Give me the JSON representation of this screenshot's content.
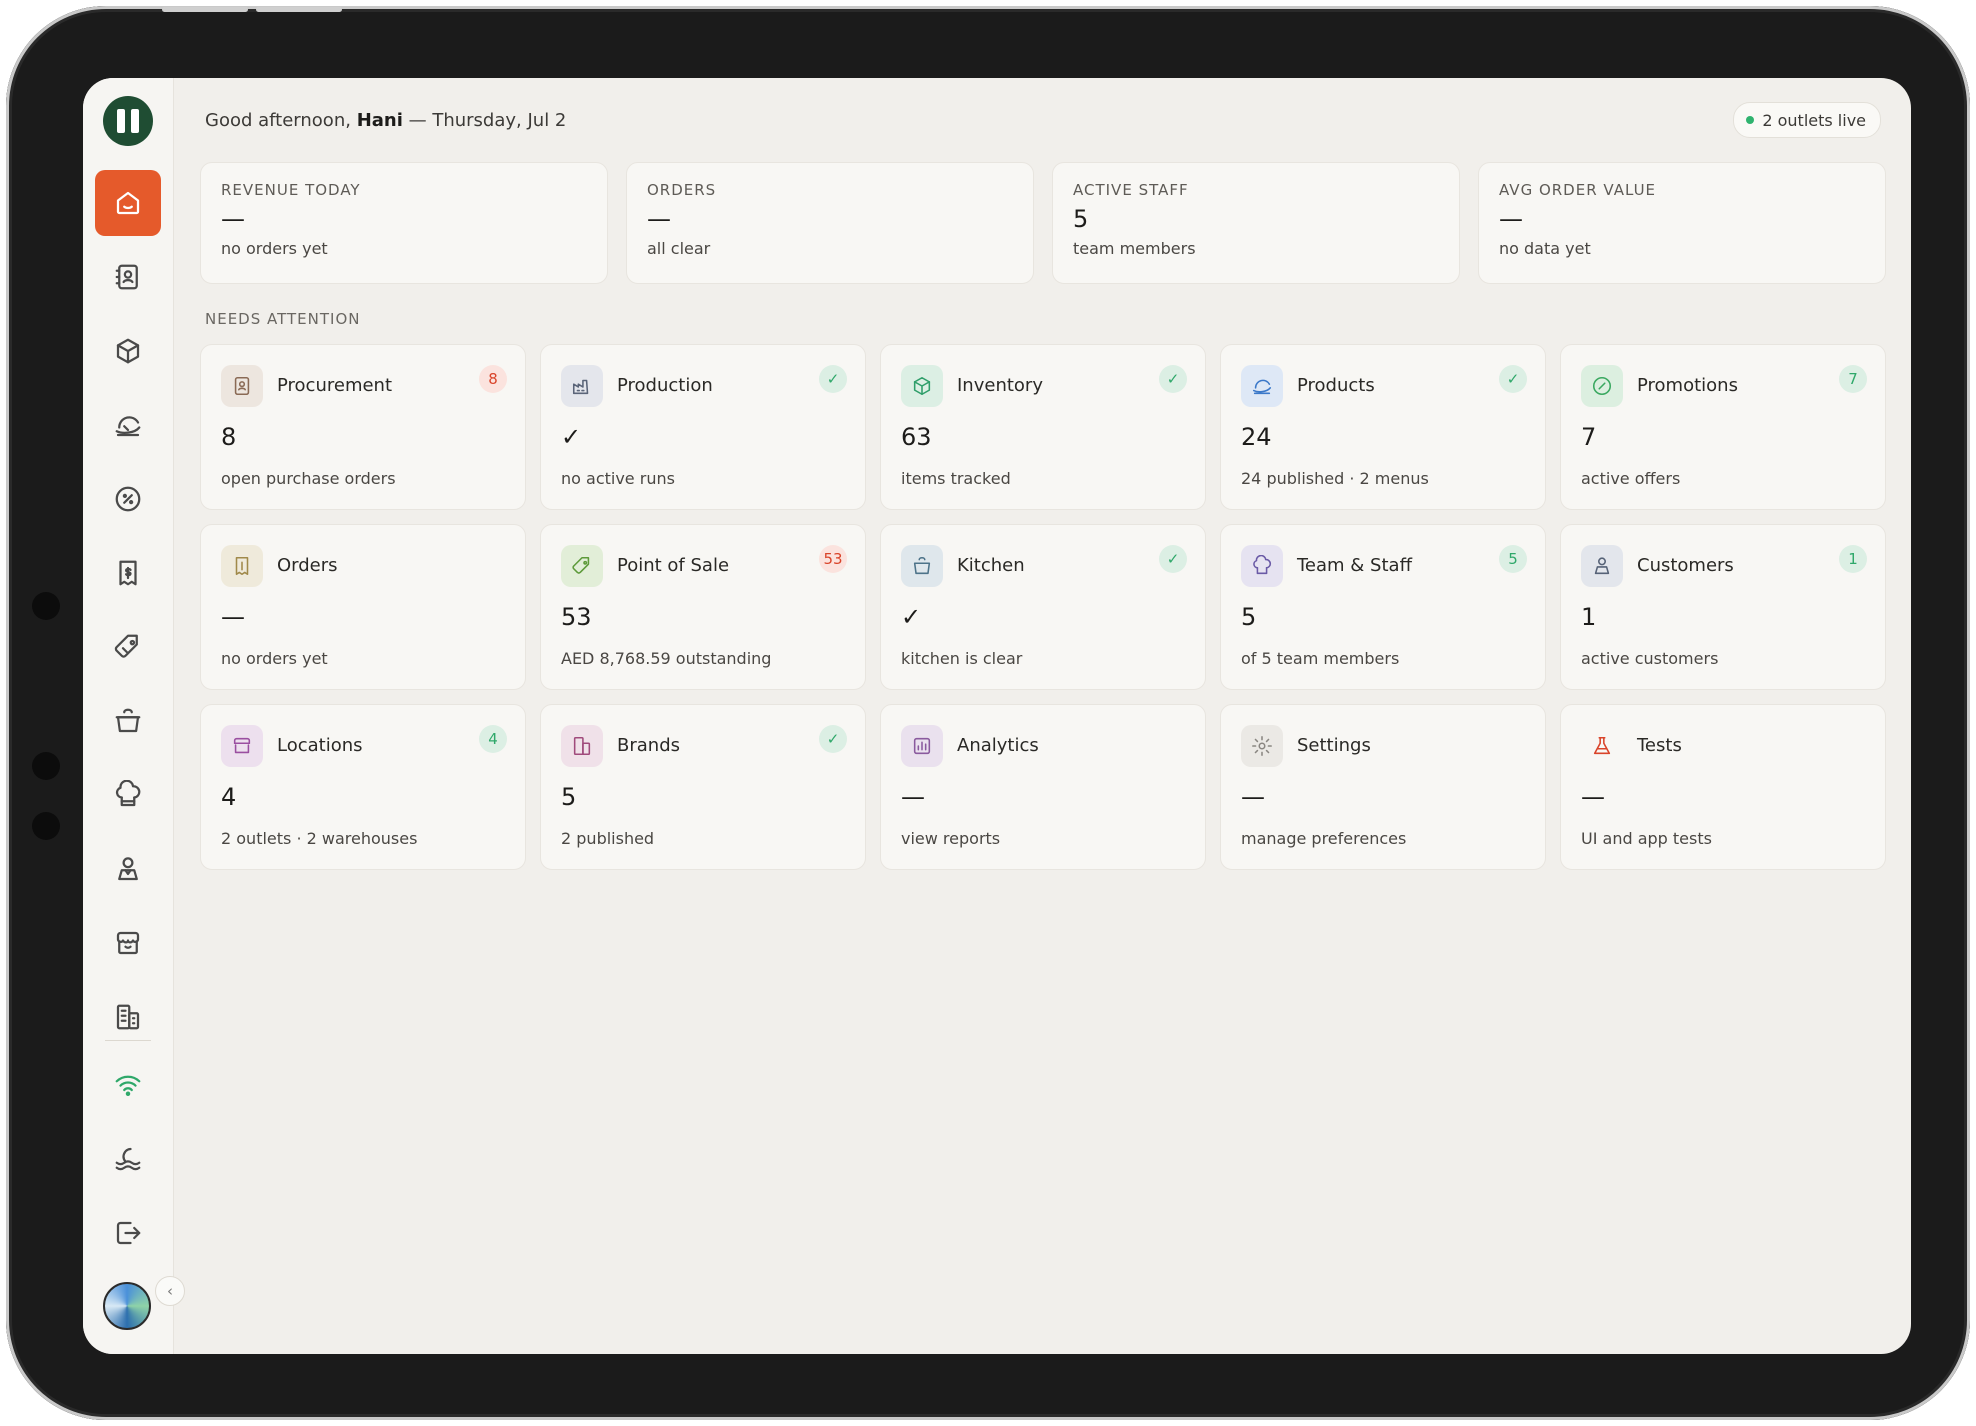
{
  "header": {
    "greeting_prefix": "Good afternoon,",
    "user_name": "Hani",
    "date_text": "— Thursday, Jul 2",
    "status_pill": "2 outlets live"
  },
  "stats": [
    {
      "label": "REVENUE TODAY",
      "value": "—",
      "sub": "no orders yet"
    },
    {
      "label": "ORDERS",
      "value": "—",
      "sub": "all clear"
    },
    {
      "label": "ACTIVE STAFF",
      "value": "5",
      "sub": "team members"
    },
    {
      "label": "AVG ORDER VALUE",
      "value": "—",
      "sub": "no data yet"
    }
  ],
  "section_title": "NEEDS ATTENTION",
  "cards": [
    {
      "title": "Procurement",
      "value": "8",
      "sub": "open purchase orders",
      "badge": "8"
    },
    {
      "title": "Production",
      "value": "✓",
      "sub": "no active runs",
      "badge": "✓"
    },
    {
      "title": "Inventory",
      "value": "63",
      "sub": "items tracked",
      "badge": "✓"
    },
    {
      "title": "Products",
      "value": "24",
      "sub": "24 published · 2 menus",
      "badge": "✓"
    },
    {
      "title": "Promotions",
      "value": "7",
      "sub": "active offers",
      "badge": "7"
    },
    {
      "title": "Orders",
      "value": "—",
      "sub": "no orders yet",
      "badge": ""
    },
    {
      "title": "Point of Sale",
      "value": "53",
      "sub": "AED 8,768.59 outstanding",
      "badge": "53"
    },
    {
      "title": "Kitchen",
      "value": "✓",
      "sub": "kitchen is clear",
      "badge": "✓"
    },
    {
      "title": "Team & Staff",
      "value": "5",
      "sub": "of 5 team members",
      "badge": "5"
    },
    {
      "title": "Customers",
      "value": "1",
      "sub": "active customers",
      "badge": "1"
    },
    {
      "title": "Locations",
      "value": "4",
      "sub": "2 outlets · 2 warehouses",
      "badge": "4"
    },
    {
      "title": "Brands",
      "value": "5",
      "sub": "2 published",
      "badge": "✓"
    },
    {
      "title": "Analytics",
      "value": "—",
      "sub": "view reports",
      "badge": ""
    },
    {
      "title": "Settings",
      "value": "—",
      "sub": "manage preferences",
      "badge": ""
    },
    {
      "title": "Tests",
      "value": "—",
      "sub": "UI and app tests",
      "badge": ""
    }
  ],
  "colors": {
    "accent": "#e55a2b",
    "brand": "#1f4d33",
    "badge_red": "#d9442a",
    "badge_green": "#2fa86a",
    "live_dot": "#2fb36f"
  },
  "sidebar_icons": [
    "home-icon",
    "contacts-icon",
    "box-icon",
    "satellite-dish-icon",
    "percent-badge-icon",
    "receipt-icon",
    "tag-icon",
    "cooking-pot-icon",
    "chef-hat-icon",
    "person-icon",
    "store-icon",
    "buildings-icon",
    "wifi-icon",
    "waves-icon",
    "logout-icon"
  ]
}
